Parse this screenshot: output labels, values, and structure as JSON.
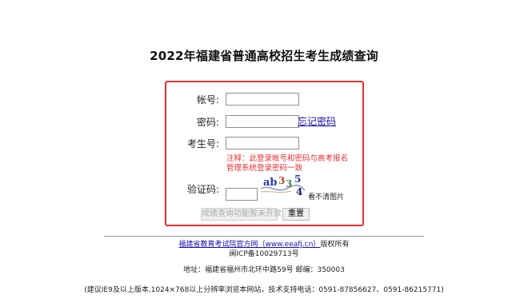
{
  "page": {
    "title": "2022年福建省普通高校招生考生成绩查询"
  },
  "form": {
    "account_label": "帐号:",
    "account_value": "",
    "password_label": "密码:",
    "password_value": "",
    "forgot_password_link": "忘记密码",
    "exam_number_label": "考生号:",
    "exam_number_value": "",
    "notice_line1": "注释：此登录帐号和密码与高考报名",
    "notice_line2": "管理系统登录密码一致",
    "captcha_label": "验证码:",
    "captcha_value": "",
    "captcha_chars": [
      "ab",
      "3",
      "3",
      "5",
      "4"
    ],
    "captcha_refresh": "看不清图片",
    "query_button": "成绩查询功能暂未开放",
    "reset_button": "重置",
    "accent_color": "#e3312f"
  },
  "footer": {
    "copyright_link": "福建省教育考试院官方网（www.eeafj.cn）",
    "copyright_suffix": "版权所有",
    "icp": "闽ICP备10029713号",
    "address": "地址：福建省福州市北环中路59号 邮编：350003",
    "recommendation": "(建议IE9及以上版本,1024×768以上分辨率浏览本网站，技术支持电话：0591-87856627、0591-86215771)"
  }
}
